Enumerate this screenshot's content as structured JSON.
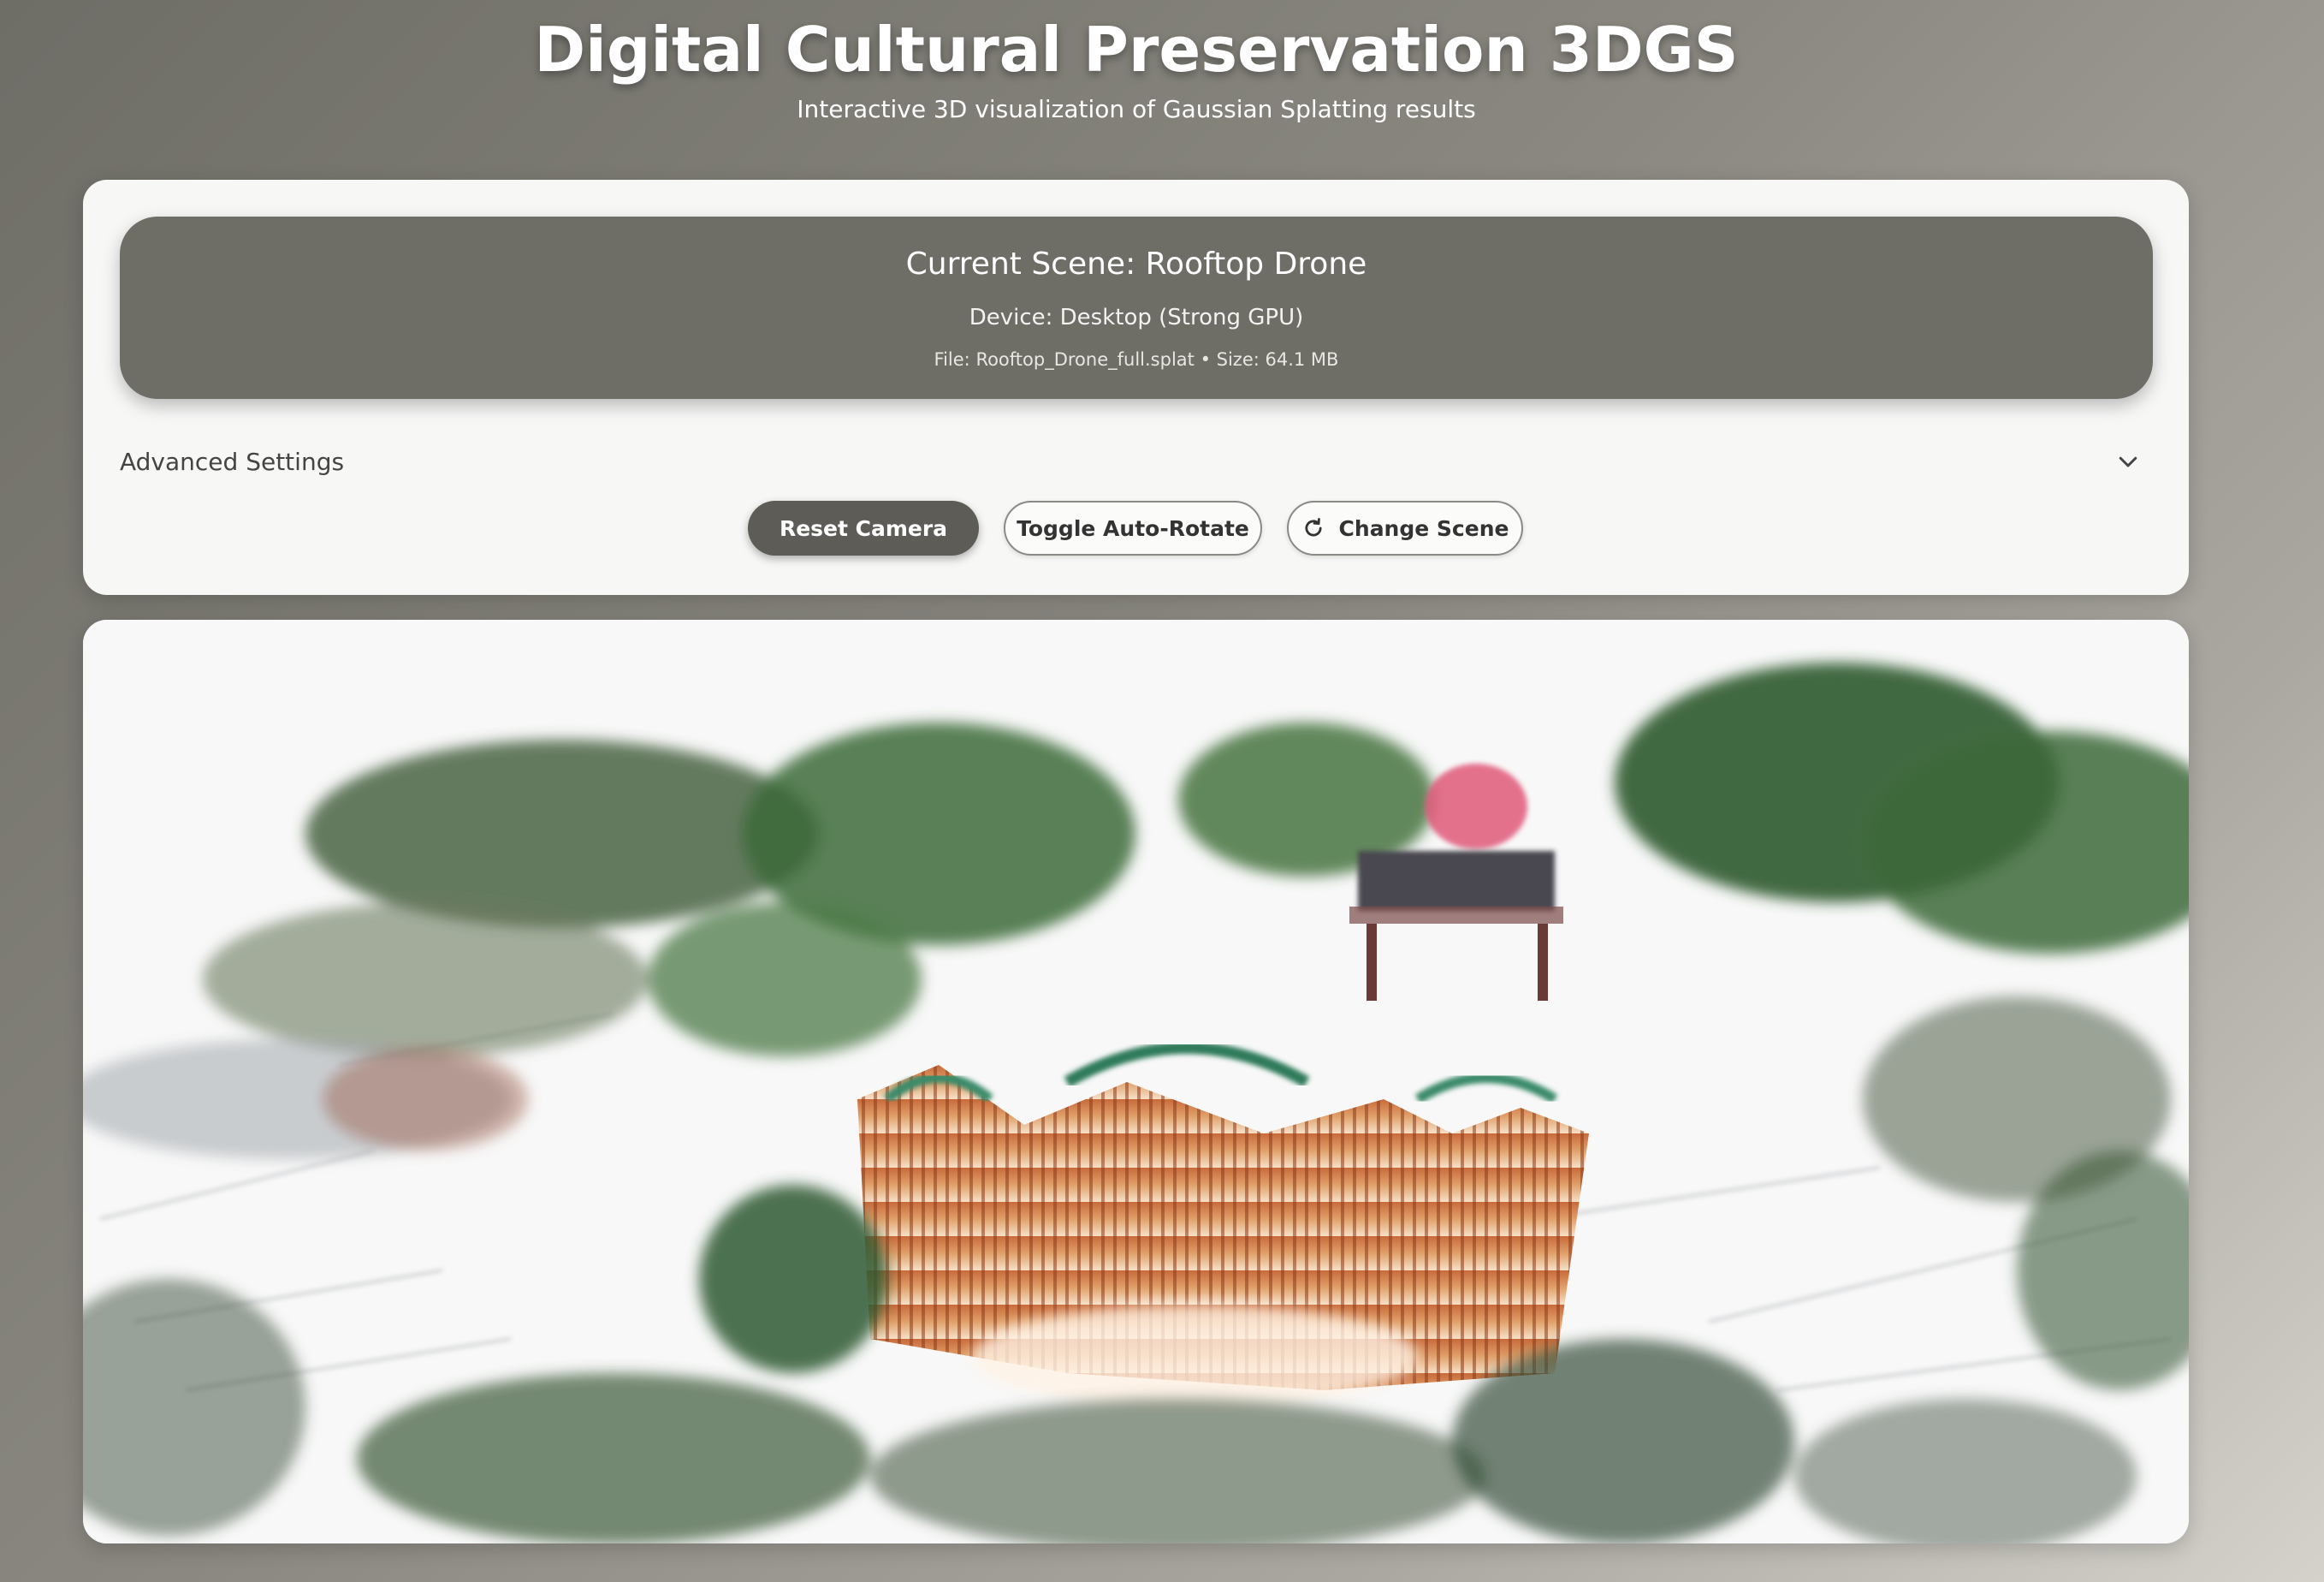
{
  "header": {
    "title": "Digital Cultural Preservation 3DGS",
    "subtitle": "Interactive 3D visualization of Gaussian Splatting results"
  },
  "scene_info": {
    "current_scene": "Current Scene: Rooftop Drone",
    "device": "Device: Desktop (Strong GPU)",
    "file_info": "File: Rooftop_Drone_full.splat • Size: 64.1 MB"
  },
  "settings": {
    "advanced_label": "Advanced Settings",
    "chevron_icon": "chevron-down-icon"
  },
  "controls": {
    "reset_camera": "Reset Camera",
    "toggle_auto_rotate": "Toggle Auto-Rotate",
    "change_scene": "Change Scene",
    "change_scene_icon": "refresh-icon"
  },
  "viewer": {
    "content": "3D Gaussian splat render of a temple rooftop surrounded by trees"
  }
}
